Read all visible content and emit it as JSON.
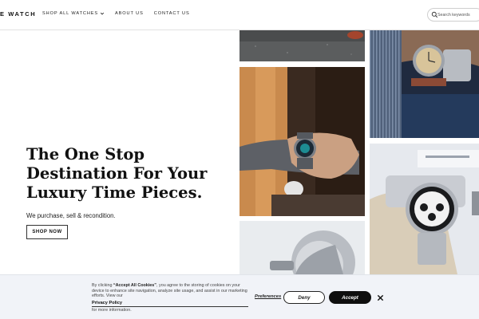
{
  "header": {
    "logo": "E WATCH",
    "nav": [
      {
        "label": "SHOP ALL WATCHES"
      },
      {
        "label": "ABOUT US"
      },
      {
        "label": "CONTACT US"
      }
    ],
    "search_placeholder": "Search keywords"
  },
  "hero": {
    "title_line1": "The One Stop",
    "title_line2": "Destination For Your",
    "title_line3": "Luxury Time Pieces.",
    "subtitle": "We purchase, sell & recondition.",
    "cta_label": "SHOP NOW"
  },
  "gallery": {
    "tiles": [
      {
        "icon": "asphalt-photo"
      },
      {
        "icon": "wrist-watch-gold-photo"
      },
      {
        "icon": "wrist-watch-blue-dial-photo"
      },
      {
        "icon": "chronograph-on-stand-photo"
      },
      {
        "icon": "watch-closeup-photo"
      }
    ]
  },
  "cookie": {
    "text_prefix": "By clicking ",
    "text_accept_quote": "“Accept All Cookies”",
    "text_rest": ", you agree to the storing of cookies on your device to enhance site navigation, analyze site usage, and assist in our marketing efforts. View our",
    "policy_link": "Privacy Policy",
    "more_info": "for more information.",
    "preferences": "Preferences",
    "deny": "Deny",
    "accept": "Accept"
  },
  "colors": {
    "accent": "#0e0e0e",
    "banner_bg": "#f1f3f8"
  }
}
